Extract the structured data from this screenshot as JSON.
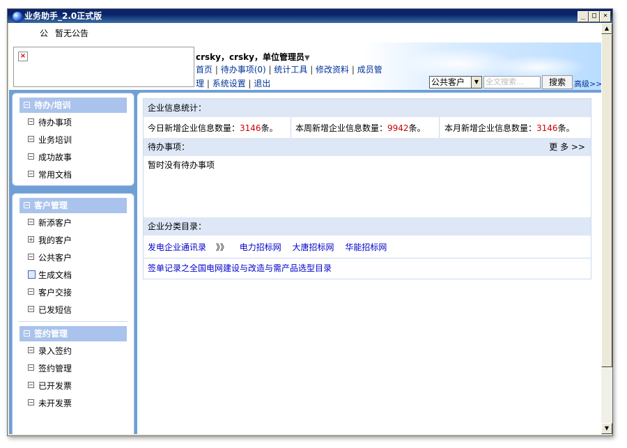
{
  "window": {
    "title": "业务助手_2.0正式版",
    "minimize": "_",
    "maximize": "□",
    "close": "×"
  },
  "notice": {
    "tag": "公",
    "text": "暂无公告"
  },
  "header": {
    "user_line": "crsky，crsky，单位管理员",
    "nav_line1": [
      {
        "label": "首页"
      },
      {
        "label": "待办事项(0)"
      },
      {
        "label": "统计工具"
      },
      {
        "label": "修改资料"
      },
      {
        "label": "成员管"
      }
    ],
    "nav_line2": [
      {
        "label": "理"
      },
      {
        "label": "系统设置"
      },
      {
        "label": "退出"
      }
    ],
    "scope_select": "公共客户",
    "search_placeholder": "全文搜索...",
    "search_button": "搜索",
    "advanced_link": "高级>>"
  },
  "sidebar": {
    "panel1": {
      "title": "待办/培训",
      "items": [
        {
          "label": "待办事项"
        },
        {
          "label": "业务培训"
        },
        {
          "label": "成功故事"
        },
        {
          "label": "常用文档"
        }
      ]
    },
    "panel2": {
      "title": "客户管理",
      "items": [
        {
          "label": "新添客户"
        },
        {
          "label": "我的客户"
        },
        {
          "label": "公共客户"
        },
        {
          "label": "生成文档"
        },
        {
          "label": "客户交接"
        },
        {
          "label": "已发短信"
        }
      ]
    },
    "panel3": {
      "title": "签约管理",
      "items": [
        {
          "label": "录入签约"
        },
        {
          "label": "签约管理"
        },
        {
          "label": "已开发票"
        },
        {
          "label": "未开发票"
        }
      ]
    }
  },
  "main": {
    "stats_title": "企业信息统计：",
    "stats": [
      {
        "prefix": "今日新增企业信息数量：",
        "value": "3146",
        "suffix": "条。"
      },
      {
        "prefix": "本周新增企业信息数量：",
        "value": "9942",
        "suffix": "条。"
      },
      {
        "prefix": "本月新增企业信息数量：",
        "value": "3146",
        "suffix": "条。"
      }
    ],
    "todo_title": "待办事项：",
    "todo_more": "更 多 >>",
    "todo_empty": "暂时没有待办事项",
    "catalog_title": "企业分类目录：",
    "catalog_row1": [
      {
        "label": "发电企业通讯录"
      },
      {
        "label": "》》"
      },
      {
        "label": "电力招标网"
      },
      {
        "label": "大唐招标网"
      },
      {
        "label": "华能招标网"
      }
    ],
    "catalog_row2": "签单记录之全国电网建设与改造与需产品选型目录"
  }
}
